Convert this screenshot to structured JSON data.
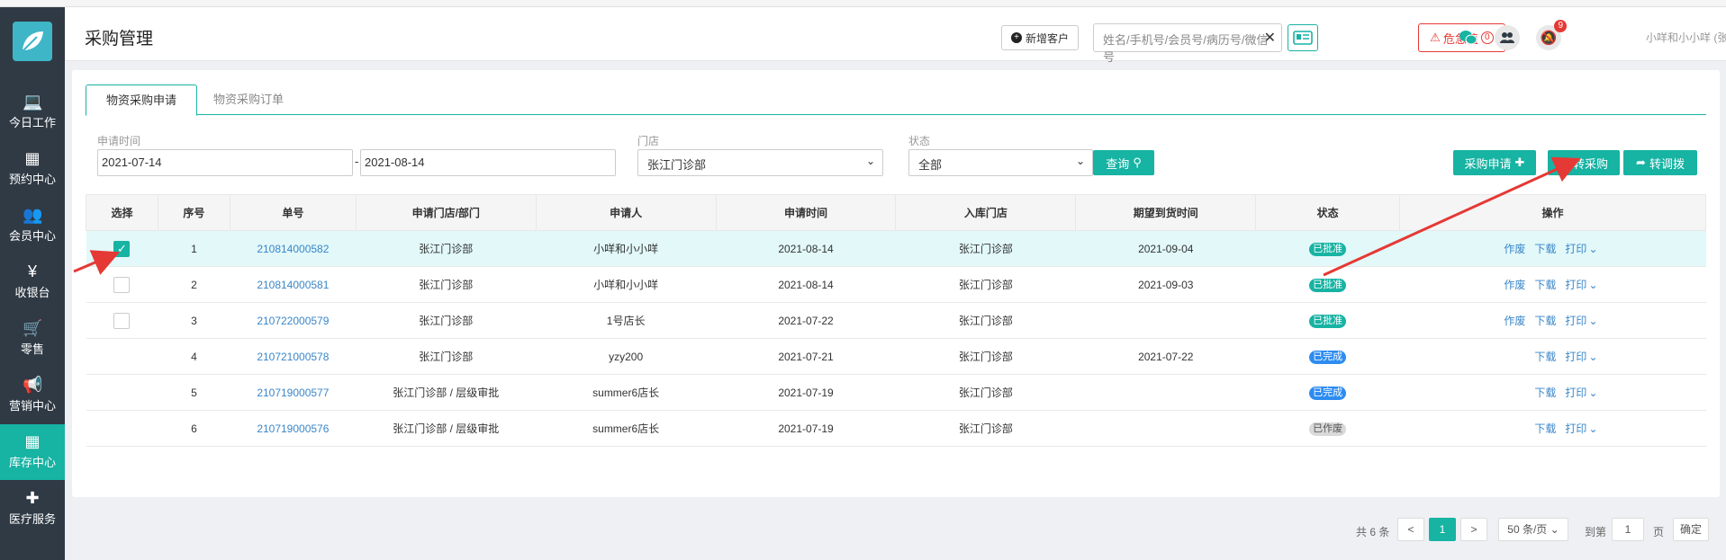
{
  "header": {
    "page_title": "采购管理",
    "new_customer": "新增客户",
    "search_placeholder": "姓名/手机号/会员号/病历号/微信号",
    "critical_value": "危急值",
    "critical_count": "0",
    "notification_count": "9",
    "user": "小咩和小小咩 (张江门诊部)"
  },
  "sidebar": [
    {
      "icon": "laptop-icon",
      "label": "今日工作"
    },
    {
      "icon": "calendar-icon",
      "label": "预约中心"
    },
    {
      "icon": "users-icon",
      "label": "会员中心"
    },
    {
      "icon": "yen-icon",
      "label": "收银台"
    },
    {
      "icon": "cart-icon",
      "label": "零售"
    },
    {
      "icon": "megaphone-icon",
      "label": "营销中心"
    },
    {
      "icon": "grid-icon",
      "label": "库存中心"
    },
    {
      "icon": "medkit-icon",
      "label": "医疗服务"
    }
  ],
  "tabs": [
    "物资采购申请",
    "物资采购订单"
  ],
  "filters": {
    "date_label": "申请时间",
    "date_from": "2021-07-14",
    "date_sep": "-",
    "date_to": "2021-08-14",
    "store_label": "门店",
    "store_value": "张江门诊部",
    "status_label": "状态",
    "status_value": "全部",
    "query_btn": "查询"
  },
  "actions": {
    "apply": "采购申请",
    "to_purchase": "转采购",
    "to_transfer": "转调拨"
  },
  "table": {
    "headers": [
      "选择",
      "序号",
      "单号",
      "申请门店/部门",
      "申请人",
      "申请时间",
      "入库门店",
      "期望到货时间",
      "状态",
      "操作"
    ],
    "rows": [
      {
        "check": "checked",
        "no": "1",
        "order": "210814000582",
        "dept": "张江门诊部",
        "applicant": "小咩和小小咩",
        "time": "2021-08-14",
        "store": "张江门诊部",
        "expected": "2021-09-04",
        "status": "已批准"
      },
      {
        "check": "empty",
        "no": "2",
        "order": "210814000581",
        "dept": "张江门诊部",
        "applicant": "小咩和小小咩",
        "time": "2021-08-14",
        "store": "张江门诊部",
        "expected": "2021-09-03",
        "status": "已批准"
      },
      {
        "check": "empty",
        "no": "3",
        "order": "210722000579",
        "dept": "张江门诊部",
        "applicant": "1号店长",
        "time": "2021-07-22",
        "store": "张江门诊部",
        "expected": "",
        "status": "已批准"
      },
      {
        "check": "none",
        "no": "4",
        "order": "210721000578",
        "dept": "张江门诊部",
        "applicant": "yzy200",
        "time": "2021-07-21",
        "store": "张江门诊部",
        "expected": "2021-07-22",
        "status": "已完成"
      },
      {
        "check": "none",
        "no": "5",
        "order": "210719000577",
        "dept": "张江门诊部 / 层级审批",
        "applicant": "summer6店长",
        "time": "2021-07-19",
        "store": "张江门诊部",
        "expected": "",
        "status": "已完成"
      },
      {
        "check": "none",
        "no": "6",
        "order": "210719000576",
        "dept": "张江门诊部 / 层级审批",
        "applicant": "summer6店长",
        "time": "2021-07-19",
        "store": "张江门诊部",
        "expected": "",
        "status": "已作废"
      }
    ],
    "op_void": "作废",
    "op_download": "下载",
    "op_print": "打印"
  },
  "pagination": {
    "total": "共 6 条",
    "prev": "<",
    "page": "1",
    "next": ">",
    "page_size": "50 条/页",
    "goto": "到第",
    "goto_value": "1",
    "page_unit": "页",
    "confirm": "确定"
  },
  "colors": {
    "accent": "#17b3a3",
    "approved": "#17b3a3",
    "done": "#2d8cf0",
    "void": "#d9d9d9",
    "danger": "#e53935"
  }
}
